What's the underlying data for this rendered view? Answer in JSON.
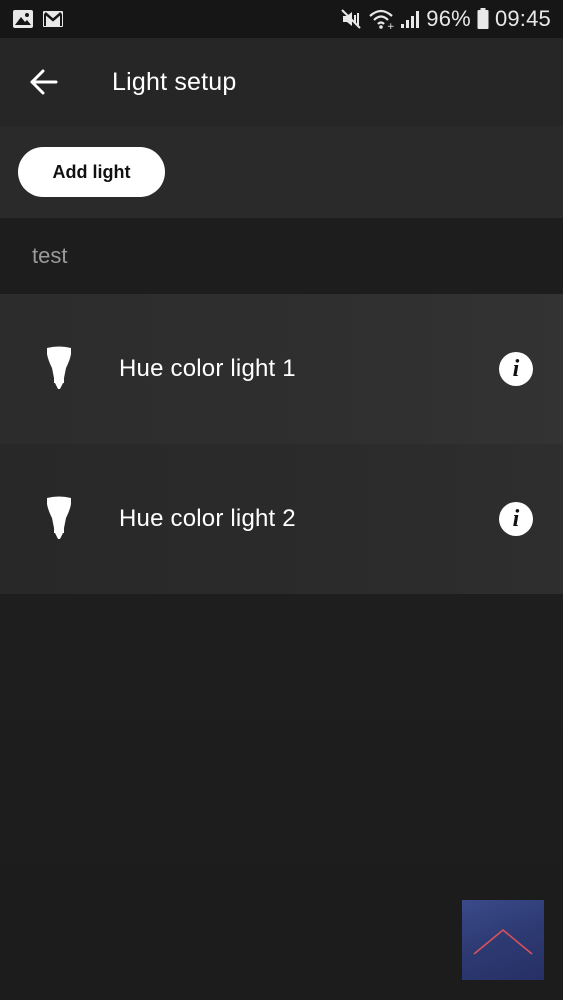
{
  "status_bar": {
    "battery": "96%",
    "time": "09:45",
    "icons_left": [
      "image-icon",
      "gmail-icon"
    ],
    "icons_right": [
      "mute-vibrate-icon",
      "wifi-icon",
      "signal-icon",
      "battery-icon"
    ]
  },
  "header": {
    "title": "Light setup",
    "back_icon": "arrow-left-icon"
  },
  "actions": {
    "add_light_label": "Add light"
  },
  "room": {
    "name": "test",
    "lights": [
      {
        "label": "Hue color light 1",
        "icon": "bulb-icon",
        "info_icon": "info-icon"
      },
      {
        "label": "Hue color light 2",
        "icon": "bulb-icon",
        "info_icon": "info-icon"
      }
    ]
  },
  "colors": {
    "background": "#1f1f1f",
    "header": "#262626",
    "room_header": "#1d1d1d",
    "button": "#ffffff"
  }
}
